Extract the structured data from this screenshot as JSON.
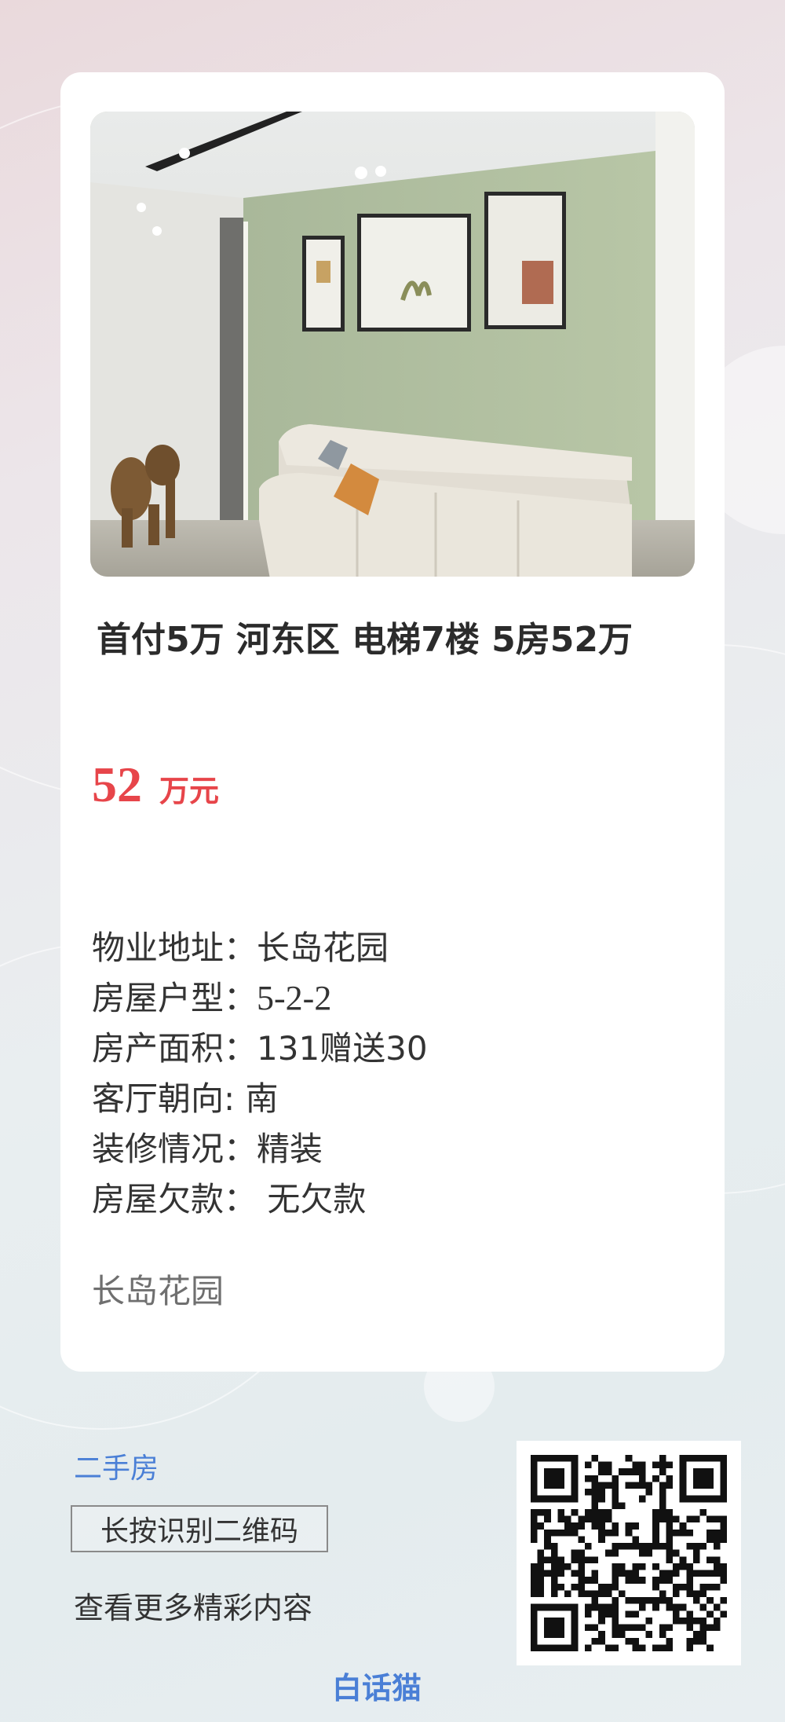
{
  "listing": {
    "title": "首付5万 河东区 电梯7楼 5房52万",
    "price_value": "52",
    "price_unit": "万元",
    "details": [
      {
        "label": "物业地址：",
        "value": "长岛花园"
      },
      {
        "label": "房屋户型：",
        "value": "5-2-2"
      },
      {
        "label": "房产面积：",
        "value": "131赠送30"
      },
      {
        "label": "客厅朝向: ",
        "value": "南"
      },
      {
        "label": "装修情况：",
        "value": "精装"
      },
      {
        "label": "房屋欠款：",
        "value": " 无欠款"
      }
    ],
    "community": "长岛花园"
  },
  "footer": {
    "category": "二手房",
    "qr_hint": "长按识别二维码",
    "more_text": "查看更多精彩内容",
    "brand": "白话猫"
  },
  "colors": {
    "price": "#e7454a",
    "link": "#4a7fd6",
    "text": "#333333"
  },
  "icons": [
    "qr-code-icon"
  ]
}
